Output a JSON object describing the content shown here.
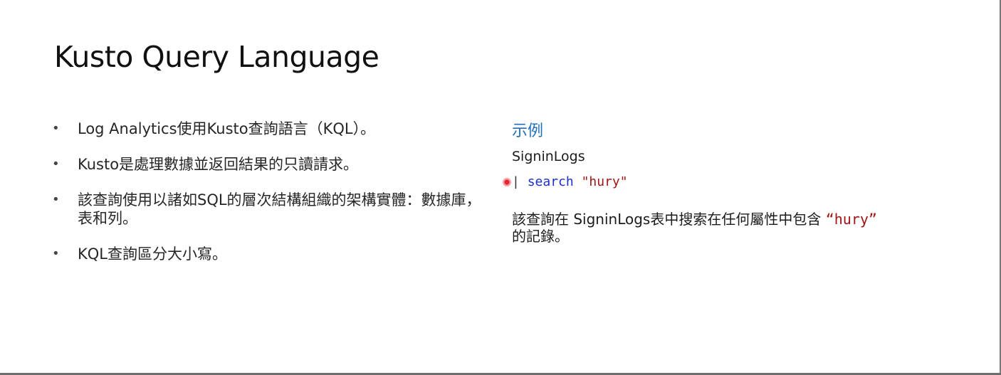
{
  "slide": {
    "title": "Kusto Query Language",
    "bullets": [
      "Log Analytics使用Kusto查詢語言（KQL）。",
      "Kusto是處理數據並返回結果的只讀請求。",
      "該查詢使用以諸如SQL的層次結構組織的架構實體：數據庫，表和列。",
      "KQL查詢區分大小寫。"
    ],
    "bullet_symbol": "•",
    "example": {
      "heading": "示例",
      "table": "SigninLogs",
      "query": {
        "pipe": "|",
        "keyword": "search",
        "string": "\"hury\""
      },
      "description": {
        "before": "該查詢在 SigninLogs表中搜索在任何屬性中包含 ",
        "quoted": "“hury”",
        "after": "的記錄。"
      }
    }
  },
  "colors": {
    "example_heading": "#1f6fbf",
    "keyword": "#1a2fd1",
    "string": "#a31515",
    "marker": "#e0262e"
  }
}
